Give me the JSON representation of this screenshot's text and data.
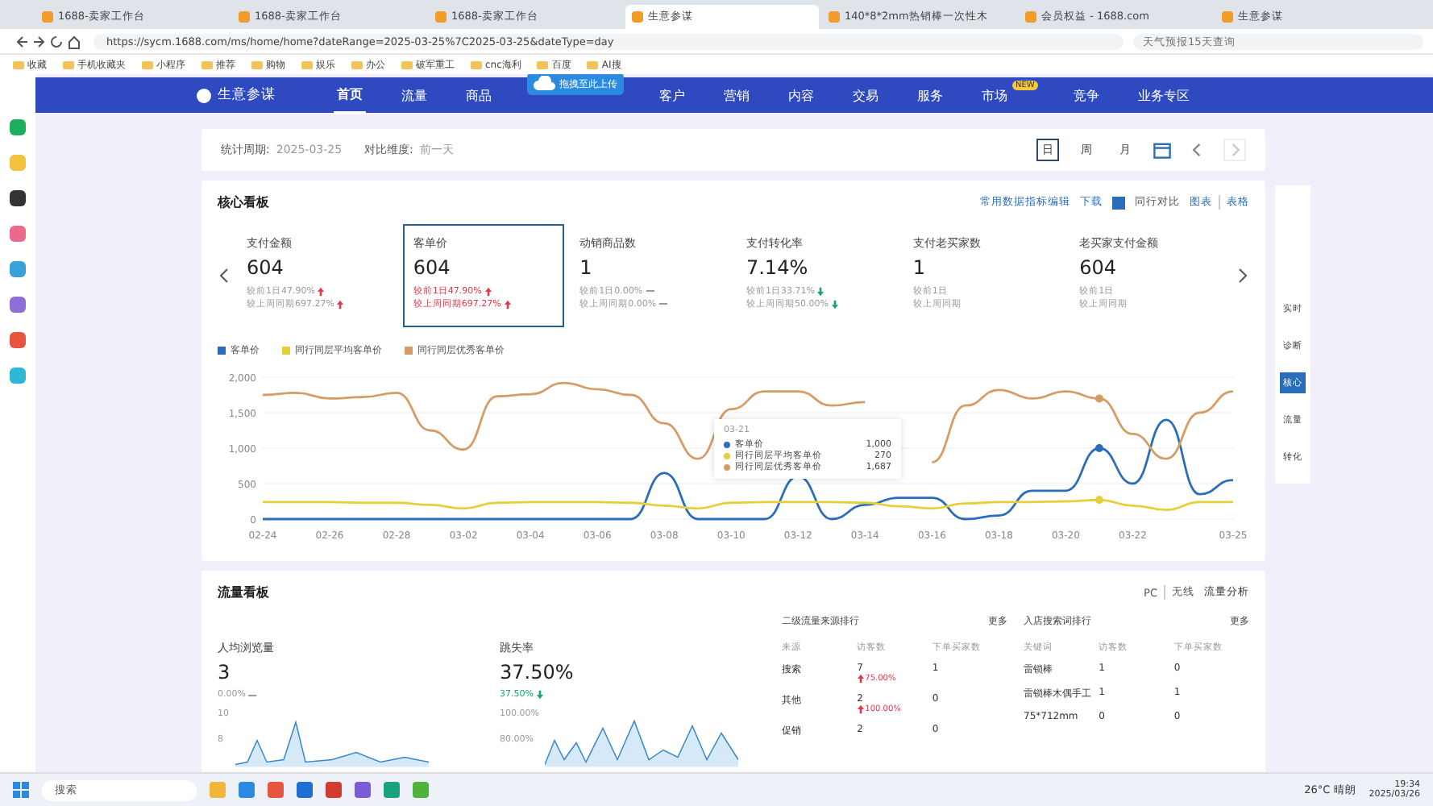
{
  "browser": {
    "tabs": [
      {
        "title": "1688-卖家工作台",
        "selected": false
      },
      {
        "title": "1688-卖家工作台",
        "selected": false
      },
      {
        "title": "1688-卖家工作台",
        "selected": false
      },
      {
        "title": "生意参谋",
        "selected": true
      },
      {
        "title": "140*8*2mm热销棒一次性木",
        "selected": false
      },
      {
        "title": "会员权益 - 1688.com",
        "selected": false
      },
      {
        "title": "生意参谋",
        "selected": false
      }
    ],
    "address": "https://sycm.1688.com/ms/home/home?dateRange=2025-03-25%7C2025-03-25&dateType=day",
    "search_placeholder": "天气预报15天查询",
    "bookmarks": [
      "收藏",
      "手机收藏夹",
      "小程序",
      "推荐",
      "购物",
      "娱乐",
      "办公",
      "破军重工",
      "cnc海利",
      "百度",
      "AI搜"
    ]
  },
  "nav": {
    "brand": "生意参谋",
    "items": [
      {
        "label": "首页",
        "selected": true
      },
      {
        "label": "流量",
        "selected": false
      },
      {
        "label": "商品",
        "selected": false
      },
      {
        "label": "客户",
        "selected": false
      },
      {
        "label": "营销",
        "selected": false
      },
      {
        "label": "内容",
        "selected": false
      },
      {
        "label": "交易",
        "selected": false
      },
      {
        "label": "服务",
        "selected": false
      },
      {
        "label": "市场",
        "selected": false,
        "badge": "NEW"
      },
      {
        "label": "竞争",
        "selected": false
      },
      {
        "label": "业务专区",
        "selected": false
      }
    ]
  },
  "upload_popup": {
    "label": "拖拽至此上传"
  },
  "filter": {
    "period_label": "统计周期:",
    "period": "2025-03-25",
    "compare_label": "对比维度:",
    "compare": "前一天",
    "granularity": [
      {
        "label": "日",
        "selected": true
      },
      {
        "label": "周",
        "selected": false
      },
      {
        "label": "月",
        "selected": false
      }
    ]
  },
  "core": {
    "title": "核心看板",
    "edit": "常用数据指标编辑",
    "download": "下载",
    "peer": {
      "label": "同行对比",
      "checked": true
    },
    "views": [
      "图表",
      "表格"
    ],
    "metrics": [
      {
        "label": "支付金额",
        "value": "604",
        "selected": false,
        "comparisons": [
          {
            "text": "较前1日47.90%",
            "kind": "up"
          },
          {
            "text": "较上周同期697.27%",
            "kind": "up"
          }
        ]
      },
      {
        "label": "客单价",
        "value": "604",
        "selected": true,
        "comparisons": [
          {
            "text": "较前1日47.90%",
            "kind": "up"
          },
          {
            "text": "较上周同期697.27%",
            "kind": "up"
          }
        ]
      },
      {
        "label": "动销商品数",
        "value": "1",
        "selected": false,
        "comparisons": [
          {
            "text": "较前1日0.00%",
            "kind": "flat"
          },
          {
            "text": "较上周同期0.00%",
            "kind": "flat"
          }
        ]
      },
      {
        "label": "支付转化率",
        "value": "7.14%",
        "selected": false,
        "comparisons": [
          {
            "text": "较前1日33.71%",
            "kind": "down"
          },
          {
            "text": "较上周同期50.00%",
            "kind": "down"
          }
        ]
      },
      {
        "label": "支付老买家数",
        "value": "1",
        "selected": false,
        "comparisons": [
          {
            "text": "较前1日",
            "kind": "plain"
          },
          {
            "text": "较上周同期",
            "kind": "plain"
          }
        ]
      },
      {
        "label": "老买家支付金额",
        "value": "604",
        "selected": false,
        "comparisons": [
          {
            "text": "较前1日",
            "kind": "plain"
          },
          {
            "text": "较上周同期",
            "kind": "plain"
          }
        ]
      }
    ],
    "chart_data": {
      "type": "line",
      "legend": "top",
      "grid": true,
      "categories": [
        "02-24",
        null,
        "02-26",
        null,
        "02-28",
        null,
        "03-02",
        null,
        "03-04",
        null,
        "03-06",
        null,
        "03-08",
        null,
        "03-10",
        null,
        "03-12",
        null,
        "03-14",
        null,
        "03-16",
        null,
        "03-18",
        null,
        "03-20",
        null,
        "03-22",
        null,
        null,
        "03-25"
      ],
      "yticks": [
        0,
        500,
        {
          "value": 1000,
          "label": "1,000"
        },
        {
          "value": 1500,
          "label": "1,500"
        },
        {
          "value": 2000,
          "label": "2,000"
        }
      ],
      "ylim": [
        0,
        2000
      ],
      "series": [
        {
          "name": "客单价",
          "color": "#2a6ebb",
          "values": [
            0,
            0,
            0,
            0,
            0,
            0,
            0,
            0,
            0,
            0,
            0,
            0,
            650,
            0,
            0,
            0,
            600,
            0,
            200,
            300,
            300,
            0,
            50,
            400,
            400,
            1000,
            500,
            1400,
            350,
            550
          ]
        },
        {
          "name": "同行同层平均客单价",
          "color": "#e5cf3a",
          "values": [
            240,
            240,
            240,
            230,
            230,
            200,
            150,
            230,
            240,
            240,
            240,
            230,
            190,
            150,
            230,
            240,
            240,
            240,
            230,
            180,
            150,
            220,
            240,
            240,
            250,
            270,
            190,
            130,
            240,
            240
          ]
        },
        {
          "name": "同行同层优秀客单价",
          "color": "#d69c66",
          "values": [
            1750,
            1780,
            1700,
            1720,
            1780,
            1250,
            980,
            1730,
            1760,
            1920,
            1830,
            1750,
            1350,
            850,
            1550,
            1800,
            1800,
            1600,
            1650,
            null,
            800,
            1600,
            1820,
            1700,
            1800,
            1700,
            1200,
            850,
            1500,
            1800
          ]
        }
      ]
    },
    "tooltip": {
      "title": "03-21",
      "rows": [
        {
          "name": "客单价",
          "value": "1,000",
          "color": "#2a6ebb"
        },
        {
          "name": "同行同层平均客单价",
          "value": "270",
          "color": "#e5cf3a"
        },
        {
          "name": "同行同层优秀客单价",
          "value": "1,687",
          "color": "#d69c66"
        }
      ]
    }
  },
  "right_rail": [
    {
      "label": "实时",
      "selected": false
    },
    {
      "label": "诊断",
      "selected": false
    },
    {
      "label": "核心",
      "selected": true
    },
    {
      "label": "流量",
      "selected": false
    },
    {
      "label": "转化",
      "selected": false
    }
  ],
  "traffic": {
    "title": "流量看板",
    "terminal": [
      "PC",
      "无线"
    ],
    "analysis": "流量分析",
    "metrics": [
      {
        "label": "人均浏览量",
        "value": "3",
        "change": "0.00%",
        "kind": "flat",
        "ticks": [
          "10",
          "8"
        ]
      },
      {
        "label": "跳失率",
        "value": "37.50%",
        "change": "37.50%",
        "kind": "down",
        "ticks": [
          "100.00%",
          "80.00%"
        ]
      }
    ],
    "tables": [
      {
        "title": "二级流量来源排行",
        "more": "更多",
        "columns": [
          "来源",
          "访客数",
          "下单买家数"
        ],
        "rows": [
          {
            "name": "搜索",
            "visitors": "7",
            "change": "75.00%",
            "kind": "up",
            "buyers": "1"
          },
          {
            "name": "其他",
            "visitors": "2",
            "change": "100.00%",
            "kind": "up",
            "buyers": "0"
          },
          {
            "name": "促销",
            "visitors": "2",
            "buyers": "0"
          }
        ]
      },
      {
        "title": "入店搜索词排行",
        "more": "更多",
        "columns": [
          "关键词",
          "访客数",
          "下单买家数"
        ],
        "rows": [
          {
            "name": "雷锁棒",
            "visitors": "1",
            "buyers": "0"
          },
          {
            "name": "雷锁棒木偶手工",
            "visitors": "1",
            "buyers": "1"
          },
          {
            "name": "75*712mm",
            "visitors": "0",
            "buyers": "0"
          }
        ]
      }
    ]
  },
  "taskbar": {
    "search": "搜索",
    "weather": "26°C 晴朗",
    "time": "19:34",
    "date": "2025/03/26"
  }
}
